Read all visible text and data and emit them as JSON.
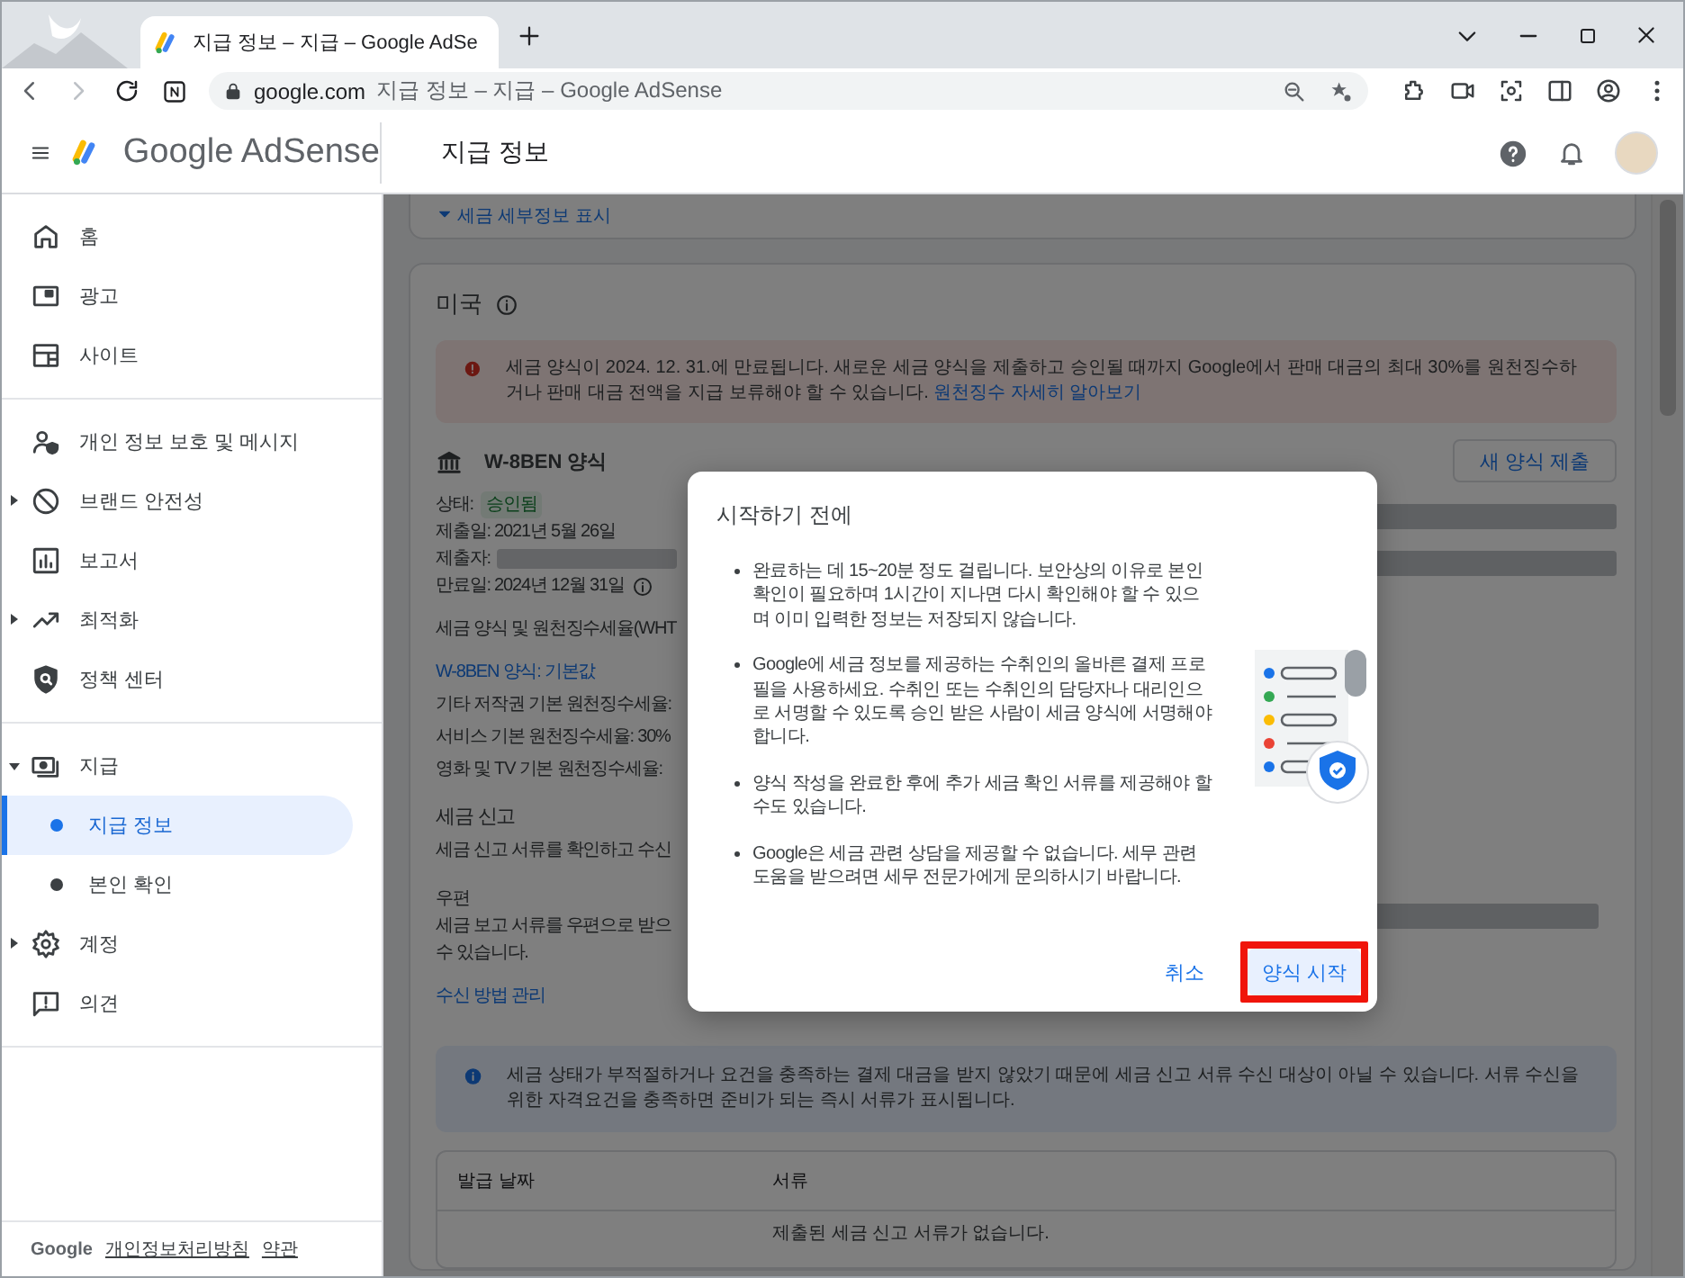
{
  "browser": {
    "tab_title": "지급 정보 – 지급 – Google AdSe",
    "url_host": "google.com",
    "url_title": "지급 정보 – 지급 – Google AdSense"
  },
  "app_header": {
    "product": "Google AdSense",
    "page_title": "지급 정보"
  },
  "sidebar": {
    "sections": [
      {
        "items": [
          {
            "kind": "link",
            "label": "홈",
            "selected": false
          },
          {
            "kind": "link",
            "label": "광고",
            "selected": false
          },
          {
            "kind": "link",
            "label": "사이트",
            "selected": false
          }
        ]
      },
      {
        "items": [
          {
            "kind": "link",
            "label": "개인 정보 보호 및 메시지",
            "selected": false
          },
          {
            "kind": "group",
            "label": "브랜드 안전성",
            "selected": false,
            "expanded": false
          },
          {
            "kind": "link",
            "label": "보고서",
            "selected": false
          },
          {
            "kind": "group",
            "label": "최적화",
            "selected": false,
            "expanded": false
          },
          {
            "kind": "link",
            "label": "정책 센터",
            "selected": false
          }
        ]
      },
      {
        "items": [
          {
            "kind": "group",
            "label": "지급",
            "selected": false,
            "expanded": true,
            "children": [
              {
                "label": "지급 정보",
                "selected": true
              },
              {
                "label": "본인 확인",
                "selected": false
              }
            ]
          },
          {
            "kind": "group",
            "label": "계정",
            "selected": false,
            "expanded": false
          },
          {
            "kind": "link",
            "label": "의견",
            "selected": false
          }
        ]
      }
    ],
    "footer": {
      "brand": "Google",
      "links": [
        "개인정보처리방침",
        "약관"
      ]
    }
  },
  "main": {
    "details_toggle": "세금 세부정보 표시",
    "country": {
      "title": "미국",
      "alert": {
        "text": "세금 양식이 2024. 12. 31.에 만료됩니다. 새로운 세금 양식을 제출하고 승인될 때까지 Google에서 판매 대금의 최대 30%를 원천징수하거나 판매 대금 전액을 지급 보류해야 할 수 있습니다.",
        "link": "원천징수 자세히 알아보기"
      },
      "form": {
        "name": "W-8BEN 양식",
        "action": "새 양식 제출",
        "status_label": "상태:",
        "status": "승인됨",
        "submitted": "제출일: 2021년 5월 26일",
        "submitter": "제출자:",
        "expires": "만료일: 2024년 12월 31일",
        "rates_title": "세금 양식 및 원천징수세율(WHT",
        "default_link": "W-8BEN 양식: 기본값",
        "rates": [
          "기타 저작권 기본 원천징수세율:",
          "서비스 기본 원천징수세율: 30%",
          "영화 및 TV 기본 원천징수세율:"
        ]
      },
      "tax_reporting": {
        "title": "세금 신고",
        "text": "세금 신고 서류를 확인하고 수신"
      },
      "mail": {
        "title": "우편",
        "lines": [
          "세금 보고 서류를 우편으로 받으",
          "수 있습니다."
        ]
      },
      "manage_link": "수신 방법 관리",
      "info": "세금 상태가 부적절하거나 요건을 충족하는 결제 대금을 받지 않았기 때문에 세금 신고 서류 수신 대상이 아닐 수 있습니다. 서류 수신을 위한 자격요건을 충족하면 준비가 되는 즉시 서류가 표시됩니다.",
      "table": {
        "columns": [
          "발급 날짜",
          "서류"
        ],
        "empty": "제출된 세금 신고 서류가 없습니다."
      }
    }
  },
  "dialog": {
    "title": "시작하기 전에",
    "bullets": [
      "완료하는 데 15~20분 정도 걸립니다. 보안상의 이유로 본인 확인이 필요하며 1시간이 지나면 다시 확인해야 할 수 있으며 이미 입력한 정보는 저장되지 않습니다.",
      "Google에 세금 정보를 제공하는 수취인의 올바른 결제 프로필을 사용하세요. 수취인 또는 수취인의 담당자나 대리인으로 서명할 수 있도록 승인 받은 사람이 세금 양식에 서명해야 합니다.",
      "양식 작성을 완료한 후에 추가 세금 확인 서류를 제공해야 할 수도 있습니다.",
      "Google은 세금 관련 상담을 제공할 수 없습니다. 세무 관련 도움을 받으려면 세무 전문가에게 문의하시기 바랍니다."
    ],
    "buttons": [
      {
        "kind": "text",
        "label": "취소",
        "highlighted": false
      },
      {
        "kind": "tonal",
        "label": "양식 시작",
        "highlighted": true
      }
    ]
  }
}
